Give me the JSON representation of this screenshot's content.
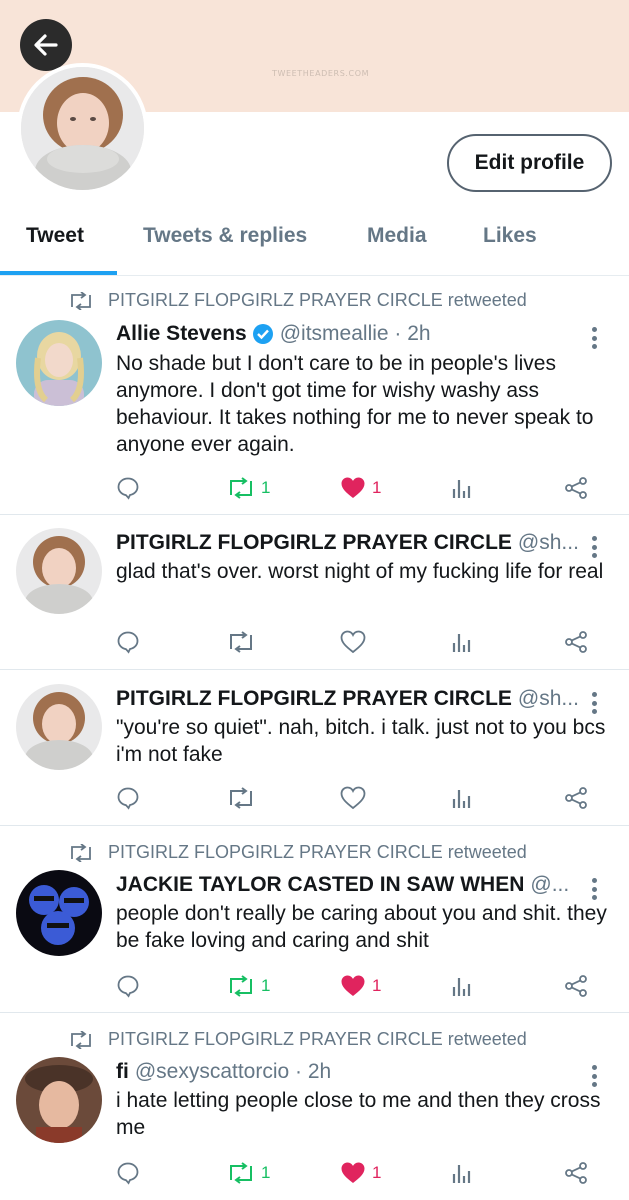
{
  "header": {
    "watermark": "TWEETHEADERS.COM",
    "back_icon": "arrow-left-icon",
    "edit_profile_label": "Edit profile"
  },
  "tabs": [
    {
      "label": "Tweet",
      "active": true
    },
    {
      "label": "Tweets & replies",
      "active": false
    },
    {
      "label": "Media",
      "active": false
    },
    {
      "label": "Likes",
      "active": false
    }
  ],
  "colors": {
    "accent": "#1da1f2",
    "banner": "#f8e4d8",
    "retweet_active": "#17bf63",
    "like_active": "#e0245e",
    "muted": "#657786"
  },
  "tweets": [
    {
      "retweeted_by": "PITGIRLZ FLOPGIRLZ PRAYER CIRCLE retweeted",
      "name": "Allie Stevens",
      "verified": true,
      "handle": "@itsmeallie · 2h",
      "text": "No shade but I don't care to be in people's lives anymore. I don't got time for wishy washy ass behaviour. It takes nothing for me to never speak to anyone ever again.",
      "retweets": "1",
      "likes": "1"
    },
    {
      "retweeted_by": "",
      "name": "PITGIRLZ FLOPGIRLZ PRAYER CIRCLE",
      "verified": false,
      "handle": "@sh...",
      "text": "glad that's over. worst night of my fucking life for real",
      "retweets": "",
      "likes": ""
    },
    {
      "retweeted_by": "",
      "name": "PITGIRLZ FLOPGIRLZ PRAYER CIRCLE",
      "verified": false,
      "handle": "@sh...",
      "text": "\"you're so quiet\". nah, bitch. i talk. just not to you bcs i'm not fake",
      "retweets": "",
      "likes": ""
    },
    {
      "retweeted_by": "PITGIRLZ FLOPGIRLZ PRAYER CIRCLE retweeted",
      "name": "JACKIE TAYLOR CASTED IN SAW WHEN",
      "verified": false,
      "handle": "@...",
      "text": "people don't really be caring about you and shit. they be fake loving and caring and shit",
      "retweets": "1",
      "likes": "1"
    },
    {
      "retweeted_by": "PITGIRLZ FLOPGIRLZ PRAYER CIRCLE retweeted",
      "name": "fi",
      "verified": false,
      "handle": "@sexyscattorcio · 2h",
      "text": "i hate letting people close to me and  then they cross me",
      "retweets": "1",
      "likes": "1"
    }
  ]
}
